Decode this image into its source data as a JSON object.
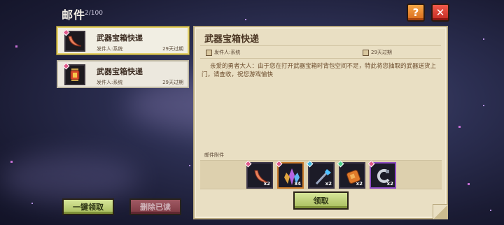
{
  "header": {
    "title": "邮件",
    "count": "2/100"
  },
  "toolbar": {
    "help_label": "?",
    "close_label": "✕"
  },
  "mails": [
    {
      "title": "武器宝箱快递",
      "sender": "发件人:系统",
      "expire": "29天过期",
      "selected": true,
      "icon": "crescent-weapon-icon"
    },
    {
      "title": "武器宝箱快递",
      "sender": "发件人:系统",
      "expire": "29天过期",
      "selected": false,
      "icon": "lantern-icon"
    }
  ],
  "buttons": {
    "claim_all": "一键领取",
    "delete_read": "删除已读",
    "claim": "领取"
  },
  "detail": {
    "title": "武器宝箱快递",
    "sender": "发件人:系统",
    "expire": "29天过期",
    "body": "亲爱的勇者大人：由于您在打开武器宝箱时背包空间不足，特此将您抽取的武器送货上门，请查收，祝您游戏愉快",
    "attachments_label": "邮件附件",
    "attachments": [
      {
        "icon": "crescent-blade-icon",
        "qty": "x2",
        "gem": "#e05a8a"
      },
      {
        "icon": "crystal-cluster-icon",
        "qty": "x4",
        "gem": "#e05a8a"
      },
      {
        "icon": "staff-icon",
        "qty": "x2",
        "gem": "#3fb6e0"
      },
      {
        "icon": "gauntlet-icon",
        "qty": "x2",
        "gem": "#4fd08a"
      },
      {
        "icon": "hook-icon",
        "qty": "x2",
        "gem": "#e05a8a"
      }
    ]
  }
}
